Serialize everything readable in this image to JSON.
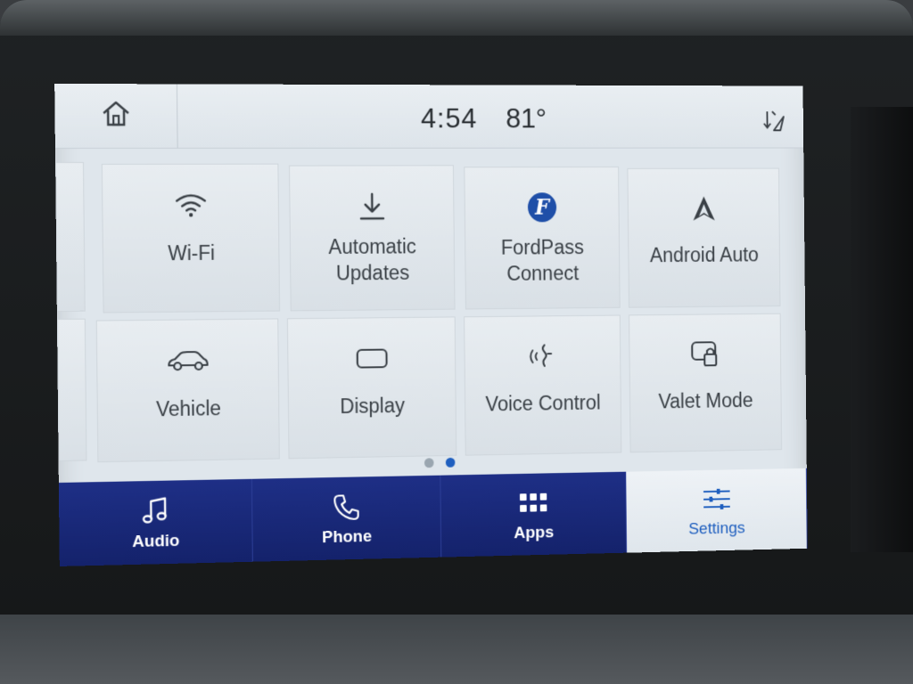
{
  "status_bar": {
    "time": "4:54",
    "temperature": "81°",
    "icons": [
      "home-icon",
      "navigation-arrows-icon"
    ]
  },
  "settings_tiles": [
    {
      "label": "Wi-Fi",
      "icon": "wifi-icon"
    },
    {
      "label_line1": "Automatic",
      "label_line2": "Updates",
      "icon": "download-icon"
    },
    {
      "label_line1": "FordPass",
      "label_line2": "Connect",
      "icon": "fordpass-icon"
    },
    {
      "label": "Android Auto",
      "icon": "android-auto-icon"
    },
    {
      "label": "Vehicle",
      "icon": "car-icon"
    },
    {
      "label": "Display",
      "icon": "display-icon"
    },
    {
      "label": "Voice Control",
      "icon": "voice-icon"
    },
    {
      "label": "Valet Mode",
      "icon": "valet-lock-icon"
    }
  ],
  "pagination": {
    "pages": 2,
    "current": 2
  },
  "bottom_nav": [
    {
      "label": "Audio",
      "icon": "music-note-icon"
    },
    {
      "label": "Phone",
      "icon": "phone-icon"
    },
    {
      "label": "Apps",
      "icon": "apps-grid-icon"
    },
    {
      "label": "Settings",
      "icon": "sliders-icon",
      "selected": true
    }
  ],
  "colors": {
    "accent_blue": "#1f5fbf",
    "nav_bar": "#1e2f86",
    "screen_bg": "#dfe6ec"
  }
}
